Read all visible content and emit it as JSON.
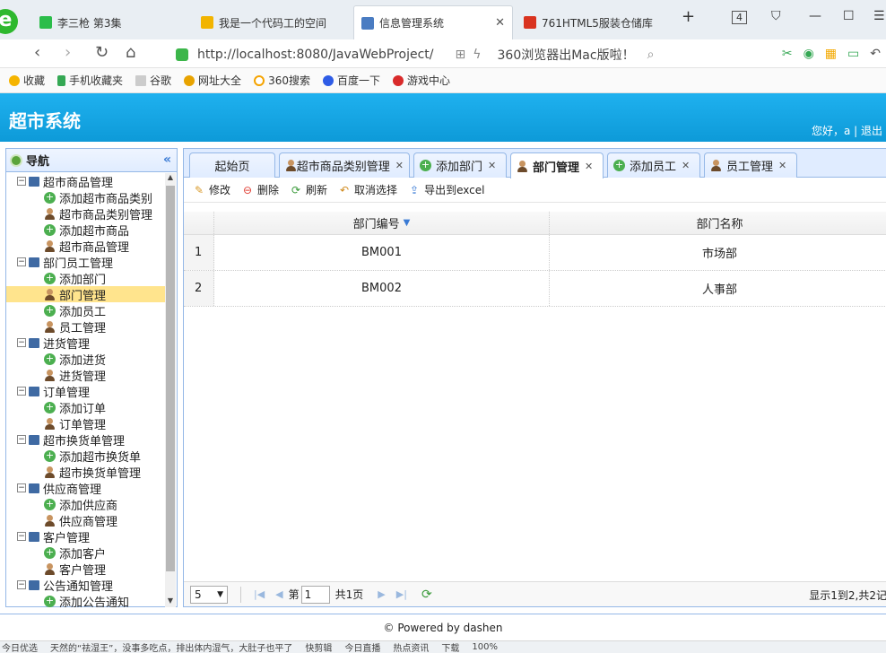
{
  "browser": {
    "tabs": [
      {
        "title": "李三枪 第3集",
        "icon_color": "#2bbd4a"
      },
      {
        "title": "我是一个代码工的空间",
        "icon_color": "#f2b400"
      },
      {
        "title": "信息管理系统",
        "icon_color": "#4a7cc2"
      },
      {
        "title": "761HTML5服装仓储库",
        "icon_color": "#d9331f"
      }
    ],
    "new_tab": "+",
    "tab_count": "4",
    "url": "http://localhost:8080/JavaWebProject/",
    "search_hint": "360浏览器出Mac版啦！",
    "bookmarks": [
      "收藏",
      "手机收藏夹",
      "谷歌",
      "网址大全",
      "360搜索",
      "百度一下",
      "游戏中心"
    ]
  },
  "app": {
    "title": "超市系统",
    "greeting": "您好，a | 退出"
  },
  "nav": {
    "title": "导航",
    "tree": [
      {
        "label": "超市商品管理",
        "type": "group"
      },
      {
        "label": "添加超市商品类别",
        "type": "add"
      },
      {
        "label": "超市商品类别管理",
        "type": "user"
      },
      {
        "label": "添加超市商品",
        "type": "add"
      },
      {
        "label": "超市商品管理",
        "type": "user"
      },
      {
        "label": "部门员工管理",
        "type": "group"
      },
      {
        "label": "添加部门",
        "type": "add"
      },
      {
        "label": "部门管理",
        "type": "user",
        "selected": true
      },
      {
        "label": "添加员工",
        "type": "add"
      },
      {
        "label": "员工管理",
        "type": "user"
      },
      {
        "label": "进货管理",
        "type": "group"
      },
      {
        "label": "添加进货",
        "type": "add"
      },
      {
        "label": "进货管理",
        "type": "user"
      },
      {
        "label": "订单管理",
        "type": "group"
      },
      {
        "label": "添加订单",
        "type": "add"
      },
      {
        "label": "订单管理",
        "type": "user"
      },
      {
        "label": "超市换货单管理",
        "type": "group"
      },
      {
        "label": "添加超市换货单",
        "type": "add"
      },
      {
        "label": "超市换货单管理",
        "type": "user"
      },
      {
        "label": "供应商管理",
        "type": "group"
      },
      {
        "label": "添加供应商",
        "type": "add"
      },
      {
        "label": "供应商管理",
        "type": "user"
      },
      {
        "label": "客户管理",
        "type": "group"
      },
      {
        "label": "添加客户",
        "type": "add"
      },
      {
        "label": "客户管理",
        "type": "user"
      },
      {
        "label": "公告通知管理",
        "type": "group"
      },
      {
        "label": "添加公告通知",
        "type": "add"
      }
    ]
  },
  "main": {
    "tabs": [
      {
        "label": "起始页",
        "icon": "none",
        "closable": false
      },
      {
        "label": "超市商品类别管理",
        "icon": "user",
        "closable": true
      },
      {
        "label": "添加部门",
        "icon": "add",
        "closable": true
      },
      {
        "label": "部门管理",
        "icon": "user",
        "closable": true,
        "active": true
      },
      {
        "label": "添加员工",
        "icon": "add",
        "closable": true
      },
      {
        "label": "员工管理",
        "icon": "user",
        "closable": true
      }
    ],
    "toolbar": {
      "edit": "修改",
      "delete": "删除",
      "refresh": "刷新",
      "cancel_select": "取消选择",
      "export": "导出到excel"
    },
    "grid": {
      "columns": [
        "部门编号",
        "部门名称"
      ],
      "rows": [
        {
          "index": "1",
          "code": "BM001",
          "name": "市场部"
        },
        {
          "index": "2",
          "code": "BM002",
          "name": "人事部"
        }
      ]
    },
    "pager": {
      "page_size": "5",
      "page_prefix": "第",
      "page": "1",
      "page_total": "共1页",
      "info": "显示1到2,共2记"
    }
  },
  "footer": {
    "text": "© Powered by dashen"
  },
  "statusbar": {
    "items": [
      "今日优选",
      "天然的“祛湿王”，没事多吃点，排出体内湿气，大肚子也平了",
      "快剪辑",
      "今日直播",
      "热点资讯",
      "下载",
      "100%"
    ]
  }
}
